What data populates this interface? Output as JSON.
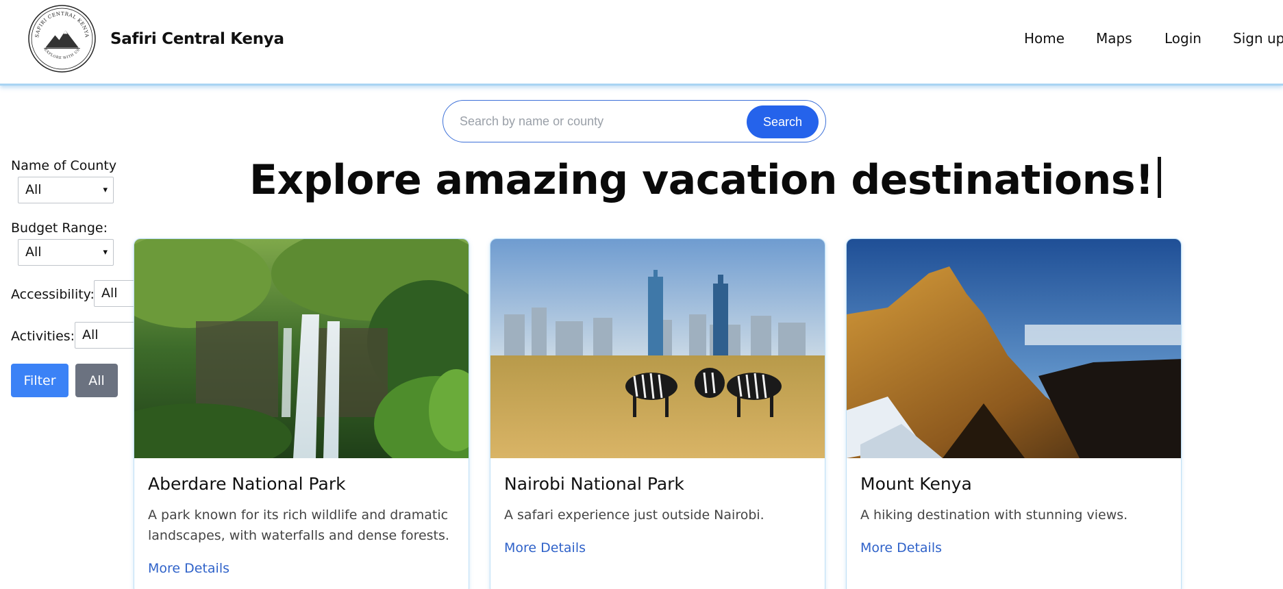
{
  "header": {
    "logo_text": "SAFIRI CENTRAL KENYA",
    "logo_subtext": "EXPLORE WITH US",
    "brand": "Safiri Central Kenya",
    "nav": [
      {
        "label": "Home"
      },
      {
        "label": "Maps"
      },
      {
        "label": "Login"
      },
      {
        "label": "Sign up"
      }
    ]
  },
  "search": {
    "placeholder": "Search by name or county",
    "value": "",
    "button_label": "Search"
  },
  "heading": "Explore amazing vacation destinations!",
  "filters": {
    "county": {
      "label": "Name of County",
      "selected": "All"
    },
    "budget": {
      "label": "Budget Range:",
      "selected": "All"
    },
    "accessibility": {
      "label": "Accessibility:",
      "selected": "All"
    },
    "activities": {
      "label": "Activities:",
      "selected": "All"
    },
    "filter_button": "Filter",
    "all_button": "All"
  },
  "cards": [
    {
      "title": "Aberdare National Park",
      "description": "A park known for its rich wildlife and dramatic landscapes, with waterfalls and dense forests.",
      "link": "More Details",
      "image": "waterfall"
    },
    {
      "title": "Nairobi National Park",
      "description": "A safari experience just outside Nairobi.",
      "link": "More Details",
      "image": "zebras-city-skyline"
    },
    {
      "title": "Mount Kenya",
      "description": "A hiking destination with stunning views.",
      "link": "More Details",
      "image": "mountain-peak"
    }
  ],
  "colors": {
    "primary": "#2563eb",
    "filter_button": "#3b82f6",
    "all_button": "#6b7280",
    "link": "#2f62c9",
    "header_border": "#a9d4f3"
  }
}
